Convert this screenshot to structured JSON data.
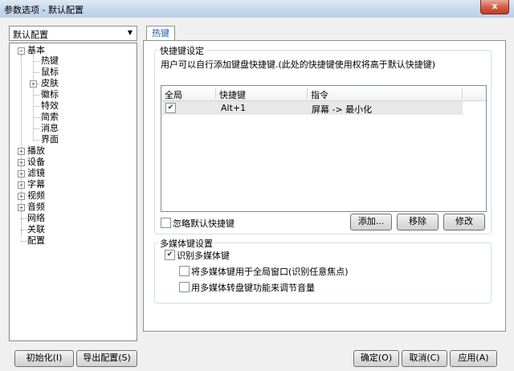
{
  "window": {
    "title": "参数选项 - 默认配置",
    "close_glyph": "x"
  },
  "profile": {
    "selected": "默认配置"
  },
  "tree": {
    "basic": "基本",
    "basic_children": [
      "热键",
      "鼠标",
      "皮肤",
      "徽标",
      "特效",
      "简索",
      "消息",
      "界面"
    ],
    "top": [
      "播放",
      "设备",
      "滤镜",
      "字幕",
      "视频",
      "音频",
      "网络",
      "关联",
      "配置"
    ]
  },
  "tab": {
    "label": "热键"
  },
  "hotkey": {
    "group_title": "快捷键设定",
    "description": "用户可以自行添加键盘快捷键.(此处的快捷键使用权将高于默认快捷键)",
    "columns": [
      "全局",
      "快捷键",
      "指令"
    ],
    "rows": [
      {
        "global": true,
        "key": "Alt+1",
        "command": "屏幕 -> 最小化"
      }
    ],
    "ignore_default": "忽略默认快捷键",
    "add": "添加...",
    "delete": "移除",
    "edit": "修改"
  },
  "media": {
    "group_title": "多媒体键设置",
    "recognize": "识别多媒体键",
    "global_window": "将多媒体键用于全局窗口(识别任意焦点)",
    "wheel_volume": "用多媒体转盘键功能来调节音量"
  },
  "footer": {
    "init": "初始化(I)",
    "export": "导出配置(S)",
    "ok": "确定(O)",
    "cancel": "取消(C)",
    "apply": "应用(A)"
  }
}
